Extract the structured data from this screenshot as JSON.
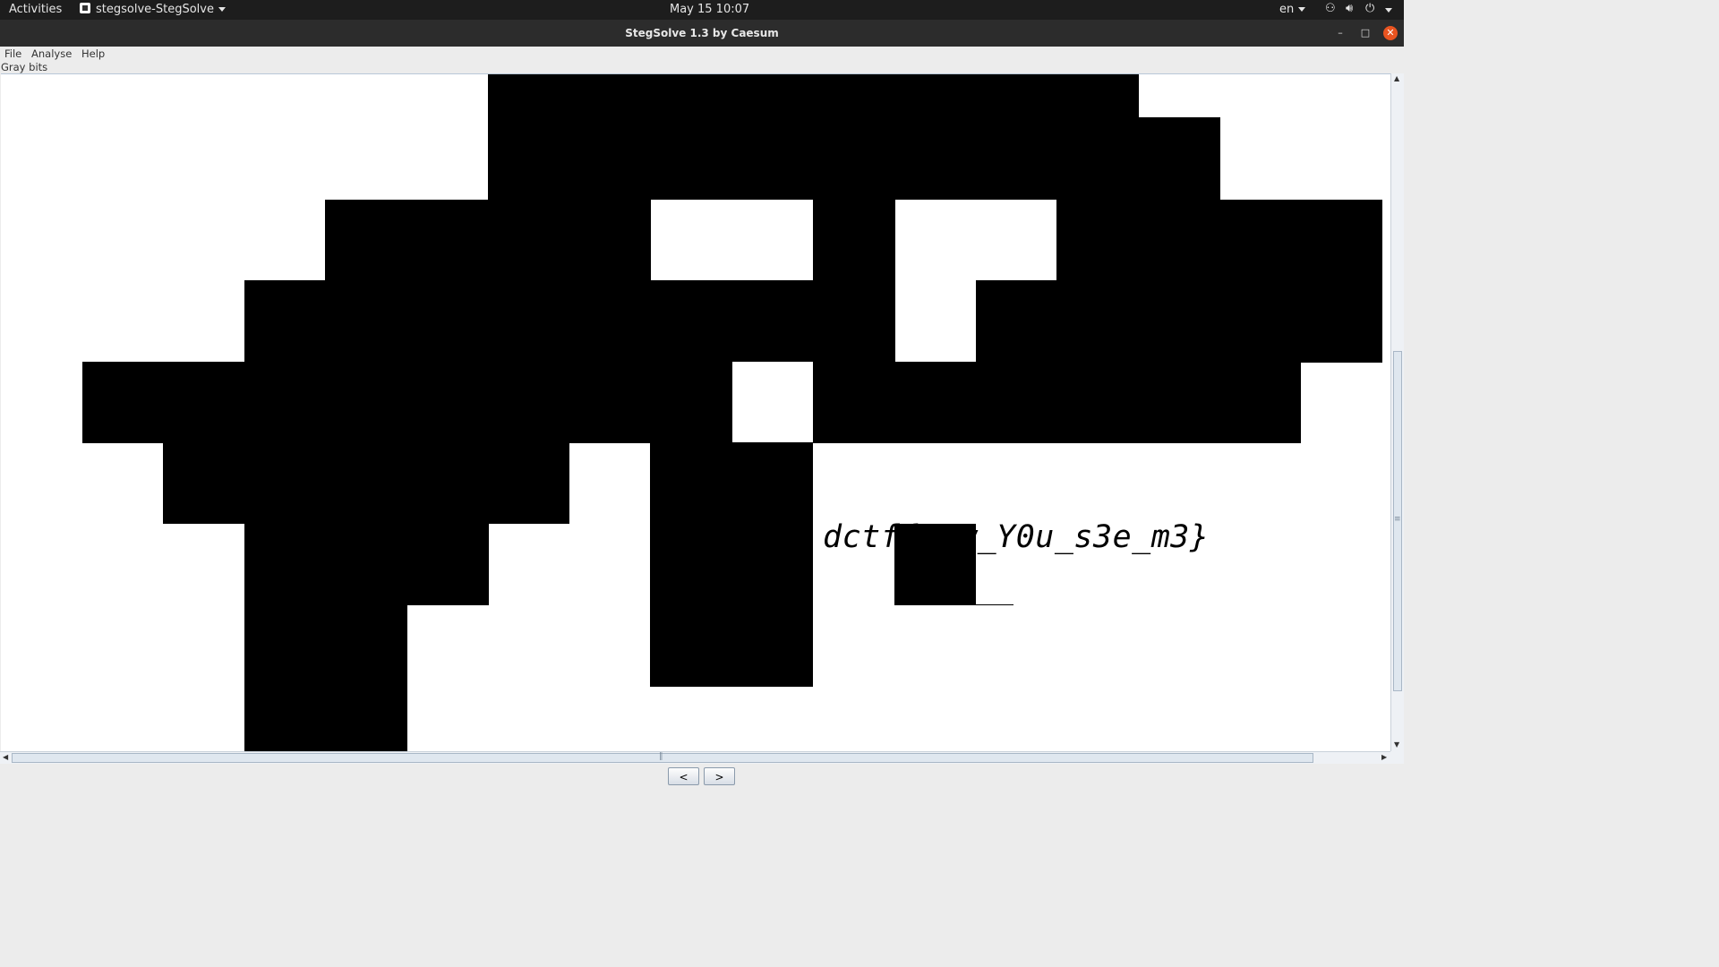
{
  "topbar": {
    "activities": "Activities",
    "app_menu": "stegsolve-StegSolve",
    "clock": "May 15  10:07",
    "language": "en"
  },
  "window": {
    "title": "StegSolve 1.3 by Caesum",
    "minimize": "–",
    "maximize": "□",
    "close": "✕"
  },
  "menubar": {
    "file": "File",
    "analyse": "Analyse",
    "help": "Help"
  },
  "mode_label": "Gray bits",
  "image": {
    "flag_text": "dctf{N0w_Y0u_s3e_m3}"
  },
  "nav": {
    "prev": "<",
    "next": ">"
  },
  "icons": {
    "network": "network-icon",
    "volume": "volume-icon",
    "power": "power-icon"
  }
}
